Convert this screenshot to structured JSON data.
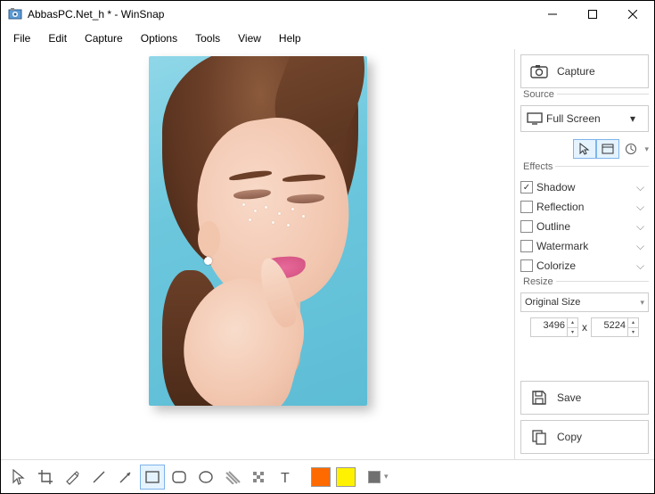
{
  "window": {
    "title": "AbbasPC.Net_h * - WinSnap"
  },
  "menu": {
    "items": [
      "File",
      "Edit",
      "Capture",
      "Options",
      "Tools",
      "View",
      "Help"
    ]
  },
  "sidebar": {
    "capture_label": "Capture",
    "source": {
      "group_label": "Source",
      "selected": "Full Screen"
    },
    "effects": {
      "group_label": "Effects",
      "shadow": "Shadow",
      "reflection": "Reflection",
      "outline": "Outline",
      "watermark": "Watermark",
      "colorize": "Colorize"
    },
    "resize": {
      "group_label": "Resize",
      "mode": "Original Size",
      "width": "3496",
      "height": "5224",
      "x": "x"
    },
    "save_label": "Save",
    "copy_label": "Copy"
  },
  "colors": {
    "accent": "#7eb4ea",
    "swatch1": "#ff6a00",
    "swatch2": "#fff200",
    "swatch3": "#707070"
  }
}
